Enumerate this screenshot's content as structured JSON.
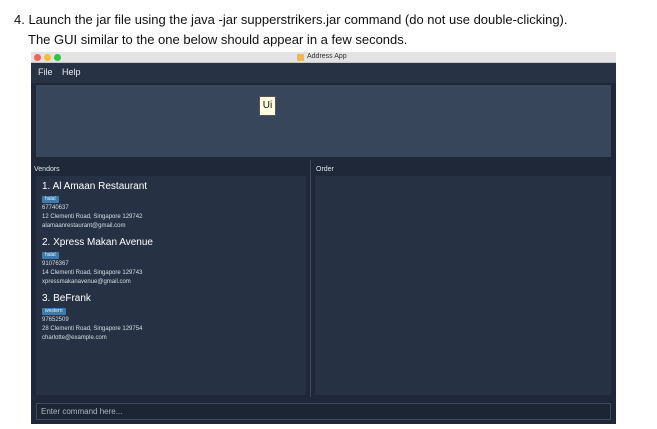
{
  "instructions": {
    "line1": "4. Launch the jar file using the java -jar supperstrikers.jar command (do not use double-clicking).",
    "line2": "The GUI similar to the one below should appear in a few seconds."
  },
  "window": {
    "title": "Address App"
  },
  "menu": {
    "file": "File",
    "help": "Help"
  },
  "tooltip": "Ui",
  "panels": {
    "vendors_label": "Vendors",
    "order_label": "Order"
  },
  "vendors": [
    {
      "title": "1.  Al Amaan Restaurant",
      "tag": "halal",
      "phone": "67740637",
      "address": "12 Clementi Road, Singapore 129742",
      "email": "alamaanrestaurant@gmail.com"
    },
    {
      "title": "2.  Xpress Makan Avenue",
      "tag": "halal",
      "phone": "91076367",
      "address": "14 Clementi Road, Singapore 129743",
      "email": "xpressmakanavenue@gmail.com"
    },
    {
      "title": "3.  BeFrank",
      "tag": "western",
      "phone": "97652509",
      "address": "28 Clementi Road, Singapore 129754",
      "email": "charlotte@example.com"
    }
  ],
  "command": {
    "placeholder": "Enter command here..."
  }
}
